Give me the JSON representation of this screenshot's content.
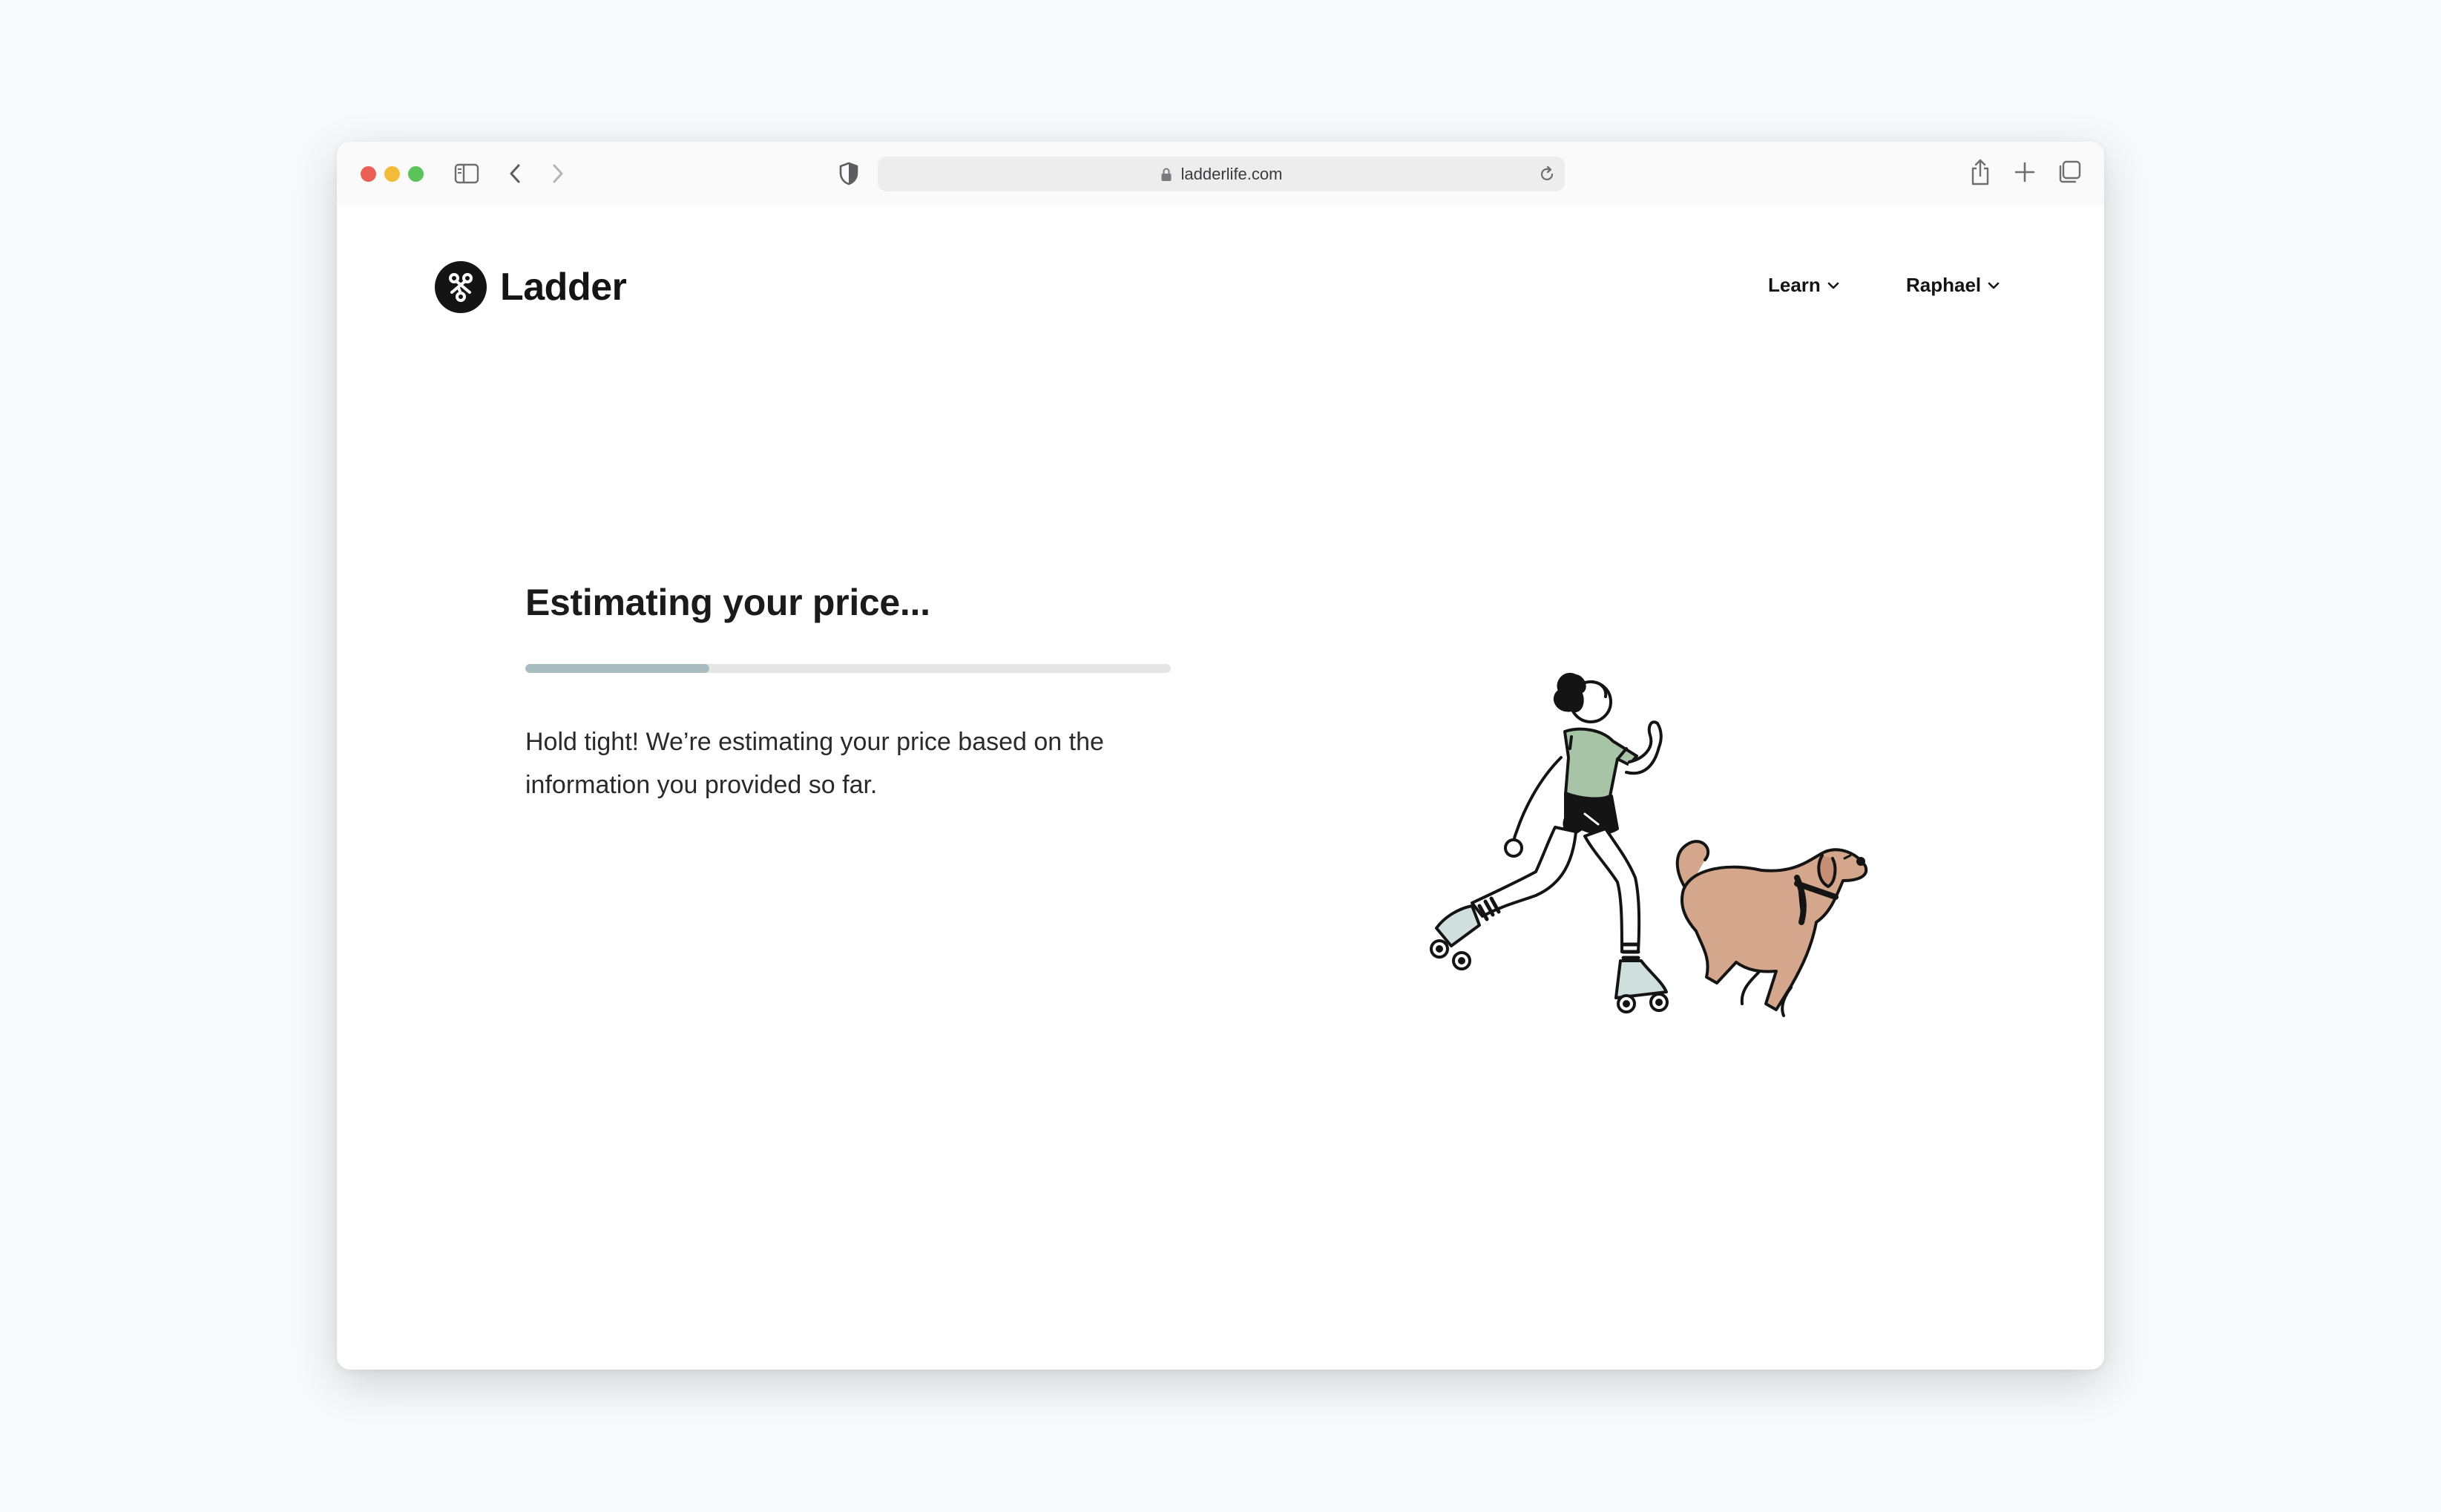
{
  "browser": {
    "url": "ladderlife.com",
    "icons": [
      "sidebar-icon",
      "back-icon",
      "forward-icon",
      "shield-icon",
      "lock-icon",
      "reload-icon",
      "share-icon",
      "new-tab-icon",
      "tabs-overview-icon"
    ]
  },
  "header": {
    "brand": "Ladder",
    "nav": {
      "learn": "Learn",
      "user": "Raphael"
    }
  },
  "main": {
    "title": "Estimating your price...",
    "progress_fraction": 0.285,
    "description": "Hold tight! We’re estimating your price based on the information you provided so far."
  },
  "colors": {
    "progress_fill": "#a9bdc1",
    "progress_track": "#e6e6e6",
    "shirt": "#a8c4a6",
    "dog": "#d4a68c",
    "skates": "#cfe0dc"
  }
}
